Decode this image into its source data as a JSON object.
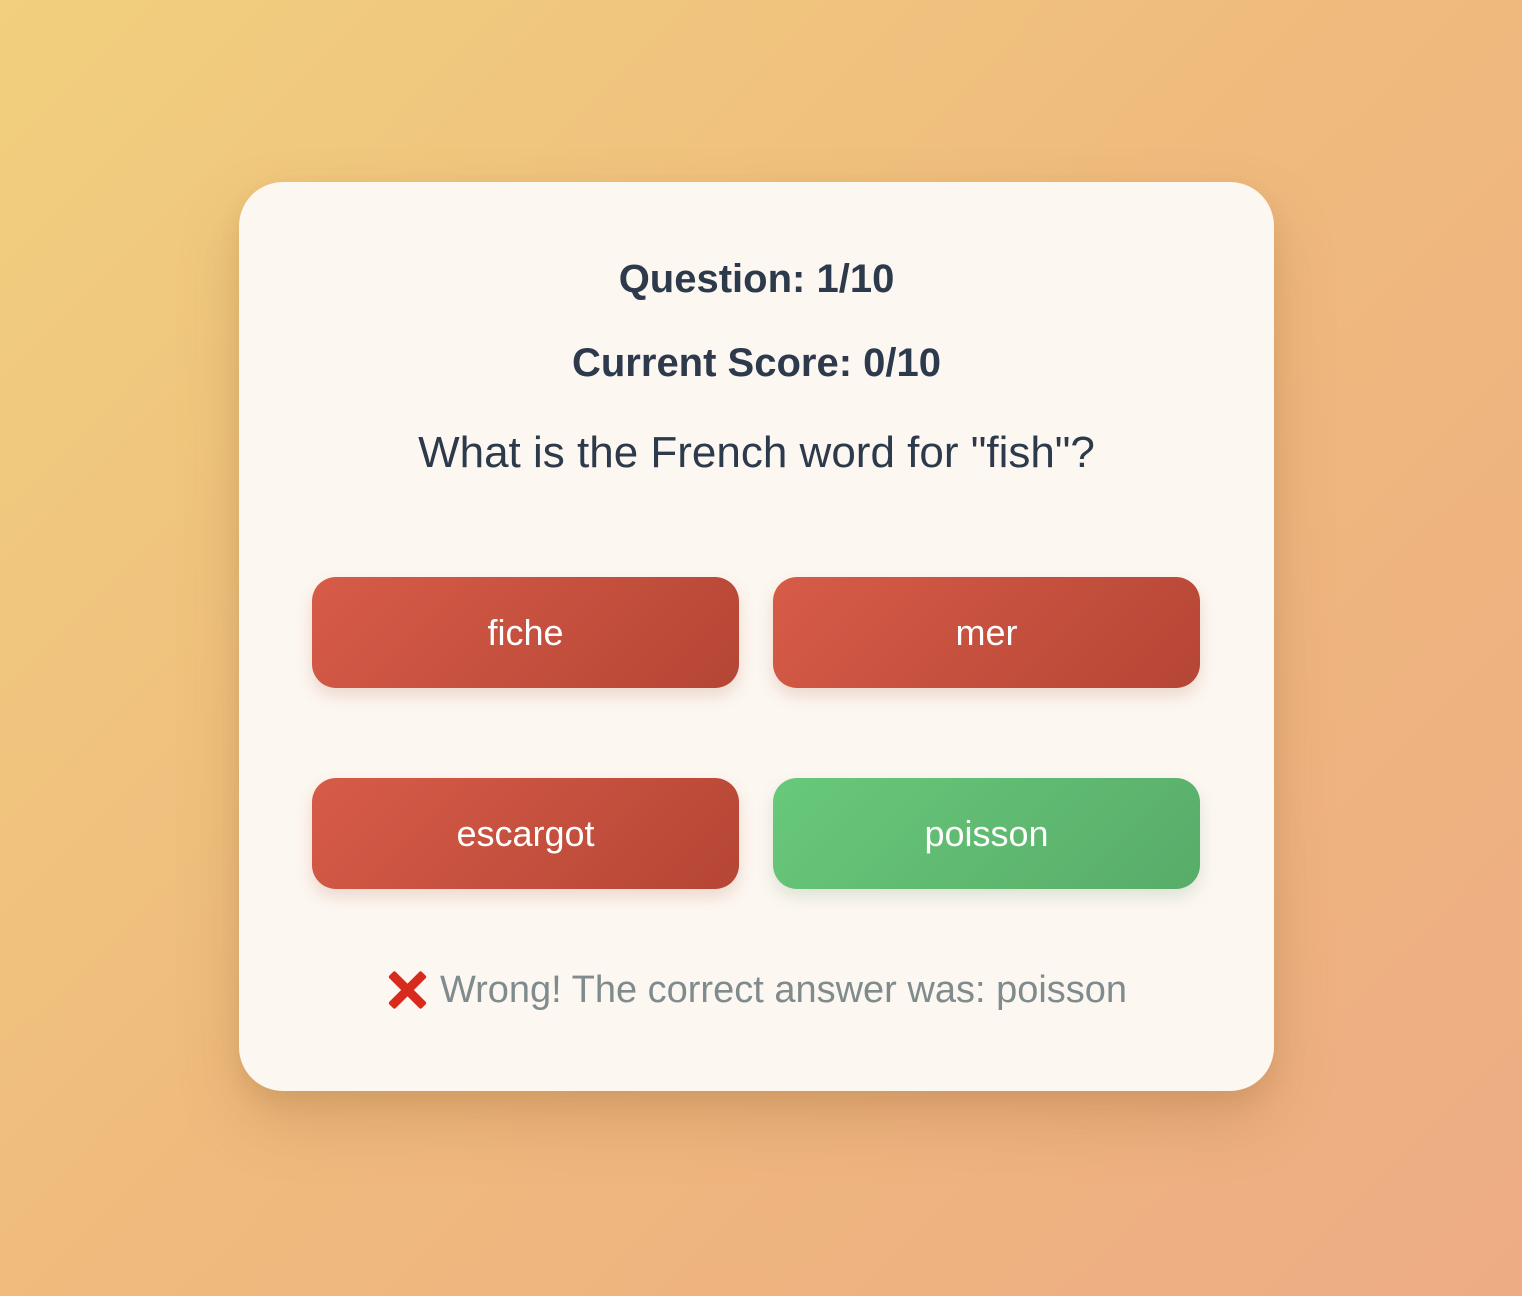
{
  "quiz": {
    "question_counter": "Question: 1/10",
    "score": "Current Score: 0/10",
    "prompt": "What is the French word for \"fish\"?",
    "options": [
      {
        "label": "fiche",
        "state": "wrong"
      },
      {
        "label": "mer",
        "state": "wrong"
      },
      {
        "label": "escargot",
        "state": "wrong"
      },
      {
        "label": "poisson",
        "state": "correct"
      }
    ],
    "feedback": {
      "icon": "cross-mark-icon",
      "text": "Wrong! The correct answer was: poisson"
    }
  },
  "colors": {
    "wrong": "#c9503f",
    "correct": "#62bc73",
    "text": "#2c3a4b",
    "feedback_text": "#7f8b8d",
    "card": "#fdf7f1"
  }
}
